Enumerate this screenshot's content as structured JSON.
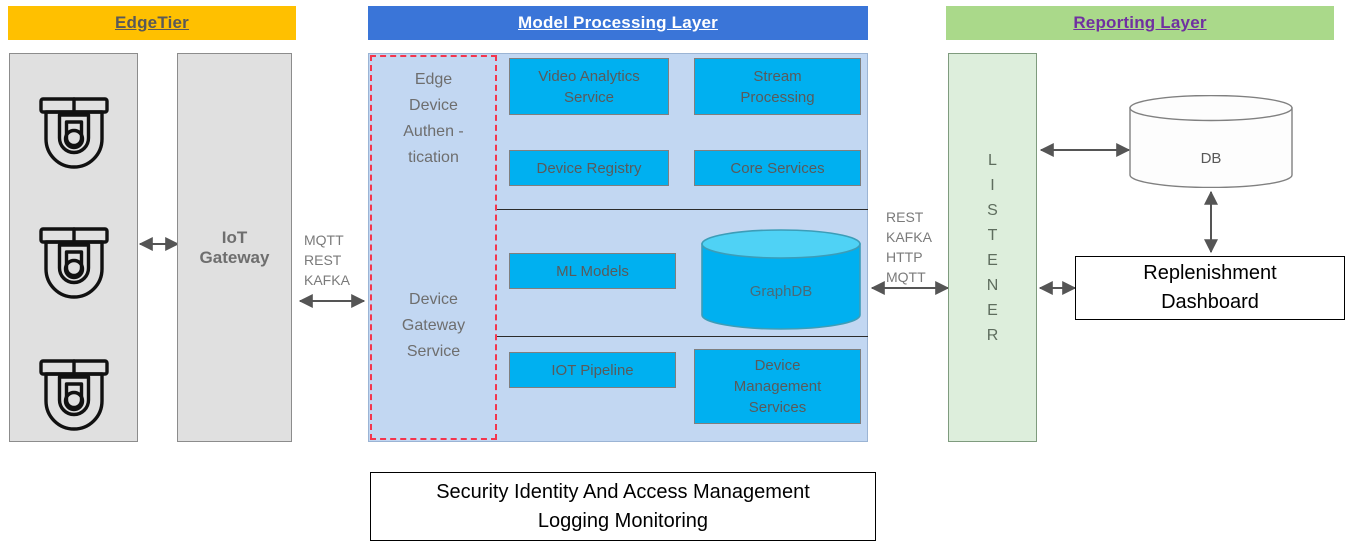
{
  "layers": {
    "edge": {
      "title": "EdgeTier",
      "color": "#FFC000"
    },
    "model": {
      "title": "Model Processing Layer",
      "color": "#3A75D8"
    },
    "reporting": {
      "title": " Reporting Layer",
      "color": "#AAD98A"
    }
  },
  "edge_tier": {
    "cameras_icon": "security-camera-icon",
    "camera_count": 3,
    "gateway_label": "IoT\nGateway",
    "gateway_line1": "IoT",
    "gateway_line2": "Gateway"
  },
  "protocols": {
    "edge_to_model": [
      "MQTT",
      "REST",
      "KAFKA"
    ],
    "model_to_listener": [
      "REST",
      "KAFKA",
      "HTTP",
      "MQTT"
    ]
  },
  "model_layer": {
    "dashed_group": {
      "top_label_lines": [
        "Edge",
        "Device",
        "Authen -",
        "tication"
      ],
      "bottom_label_lines": [
        "Device",
        "Gateway",
        "Service"
      ],
      "border_color": "#F4354D"
    },
    "services": [
      {
        "id": "video-analytics-service",
        "lines": [
          "Video Analytics",
          "Service"
        ]
      },
      {
        "id": "stream-processing",
        "lines": [
          "Stream",
          "Processing"
        ]
      },
      {
        "id": "device-registry",
        "lines": [
          "Device Registry"
        ]
      },
      {
        "id": "core-services",
        "lines": [
          "Core Services"
        ]
      },
      {
        "id": "ml-models",
        "lines": [
          "ML Models"
        ]
      },
      {
        "id": "iot-pipeline",
        "lines": [
          "IOT Pipeline"
        ]
      },
      {
        "id": "device-management-services",
        "lines": [
          "Device",
          "Management",
          "Services"
        ]
      }
    ],
    "graphdb_label": "GraphDB",
    "service_color": "#00B0F0",
    "panel_color": "#C2D7F2"
  },
  "reporting_layer": {
    "listener_letters": [
      "L",
      "I",
      "S",
      "T",
      "E",
      "N",
      "E",
      "R"
    ],
    "listener_word": "LISTENER",
    "db_label": "DB",
    "dashboard_line1": "Replenishment",
    "dashboard_line2": "Dashboard"
  },
  "footer": {
    "line1": "Security Identity And Access Management",
    "line2": "Logging Monitoring"
  }
}
